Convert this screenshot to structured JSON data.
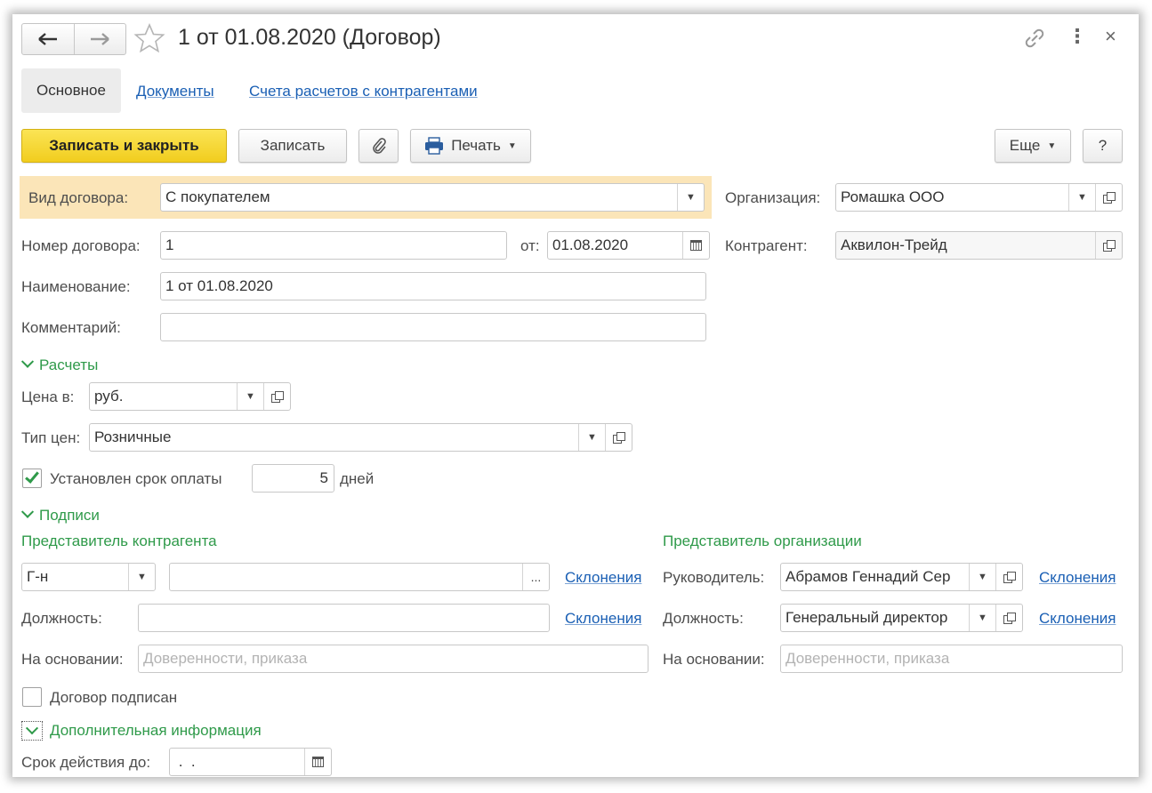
{
  "window": {
    "title": "1 от 01.08.2020 (Договор)",
    "close_symbol": "×",
    "more_symbol": "⋮"
  },
  "tabs": [
    {
      "label": "Основное",
      "active": true
    },
    {
      "label": "Документы",
      "active": false
    },
    {
      "label": "Счета расчетов с контрагентами",
      "active": false
    }
  ],
  "toolbar": {
    "save_close_label": "Записать и закрыть",
    "save_label": "Записать",
    "print_label": "Печать",
    "more_label": "Еще",
    "help_label": "?"
  },
  "form": {
    "contract_type": {
      "label": "Вид договора:",
      "value": "С покупателем"
    },
    "organization": {
      "label": "Организация:",
      "value": "Ромашка ООО"
    },
    "contract_number": {
      "label": "Номер договора:",
      "value": "1"
    },
    "date": {
      "label": "от:",
      "value": "01.08.2020"
    },
    "counterparty": {
      "label": "Контрагент:",
      "value": "Аквилон-Трейд"
    },
    "name": {
      "label": "Наименование:",
      "value": "1 от 01.08.2020"
    },
    "comment": {
      "label": "Комментарий:",
      "value": ""
    }
  },
  "settlements": {
    "title": "Расчеты",
    "price_in": {
      "label": "Цена в:",
      "value": "руб."
    },
    "price_type": {
      "label": "Тип цен:",
      "value": "Розничные"
    },
    "payment_term": {
      "label": "Установлен срок оплаты",
      "checked": true,
      "value": "5",
      "unit": "дней"
    }
  },
  "signatures": {
    "title": "Подписи",
    "counterparty_rep": {
      "title": "Представитель контрагента",
      "salutation": "Г-н",
      "name_value": "",
      "declensions": "Склонения",
      "position_label": "Должность:",
      "position_value": "",
      "position_declensions": "Склонения",
      "basis_label": "На основании:",
      "basis_placeholder": "Доверенности, приказа"
    },
    "organization_rep": {
      "title": "Представитель организации",
      "head_label": "Руководитель:",
      "head_value": "Абрамов Геннадий Сер",
      "declensions": "Склонения",
      "position_label": "Должность:",
      "position_value": "Генеральный директор",
      "position_declensions": "Склонения",
      "basis_label": "На основании:",
      "basis_placeholder": "Доверенности, приказа"
    },
    "signed": {
      "label": "Договор подписан",
      "checked": false
    }
  },
  "additional": {
    "title": "Дополнительная информация",
    "valid_until": {
      "label": "Срок действия до:",
      "value": " .  ."
    },
    "ellipsis": "..."
  },
  "colors": {
    "accent_yellow": "#f5d630",
    "section_green": "#2f9a4a",
    "link_blue": "#1a5fb4",
    "highlight_row": "#fbe5b8"
  }
}
